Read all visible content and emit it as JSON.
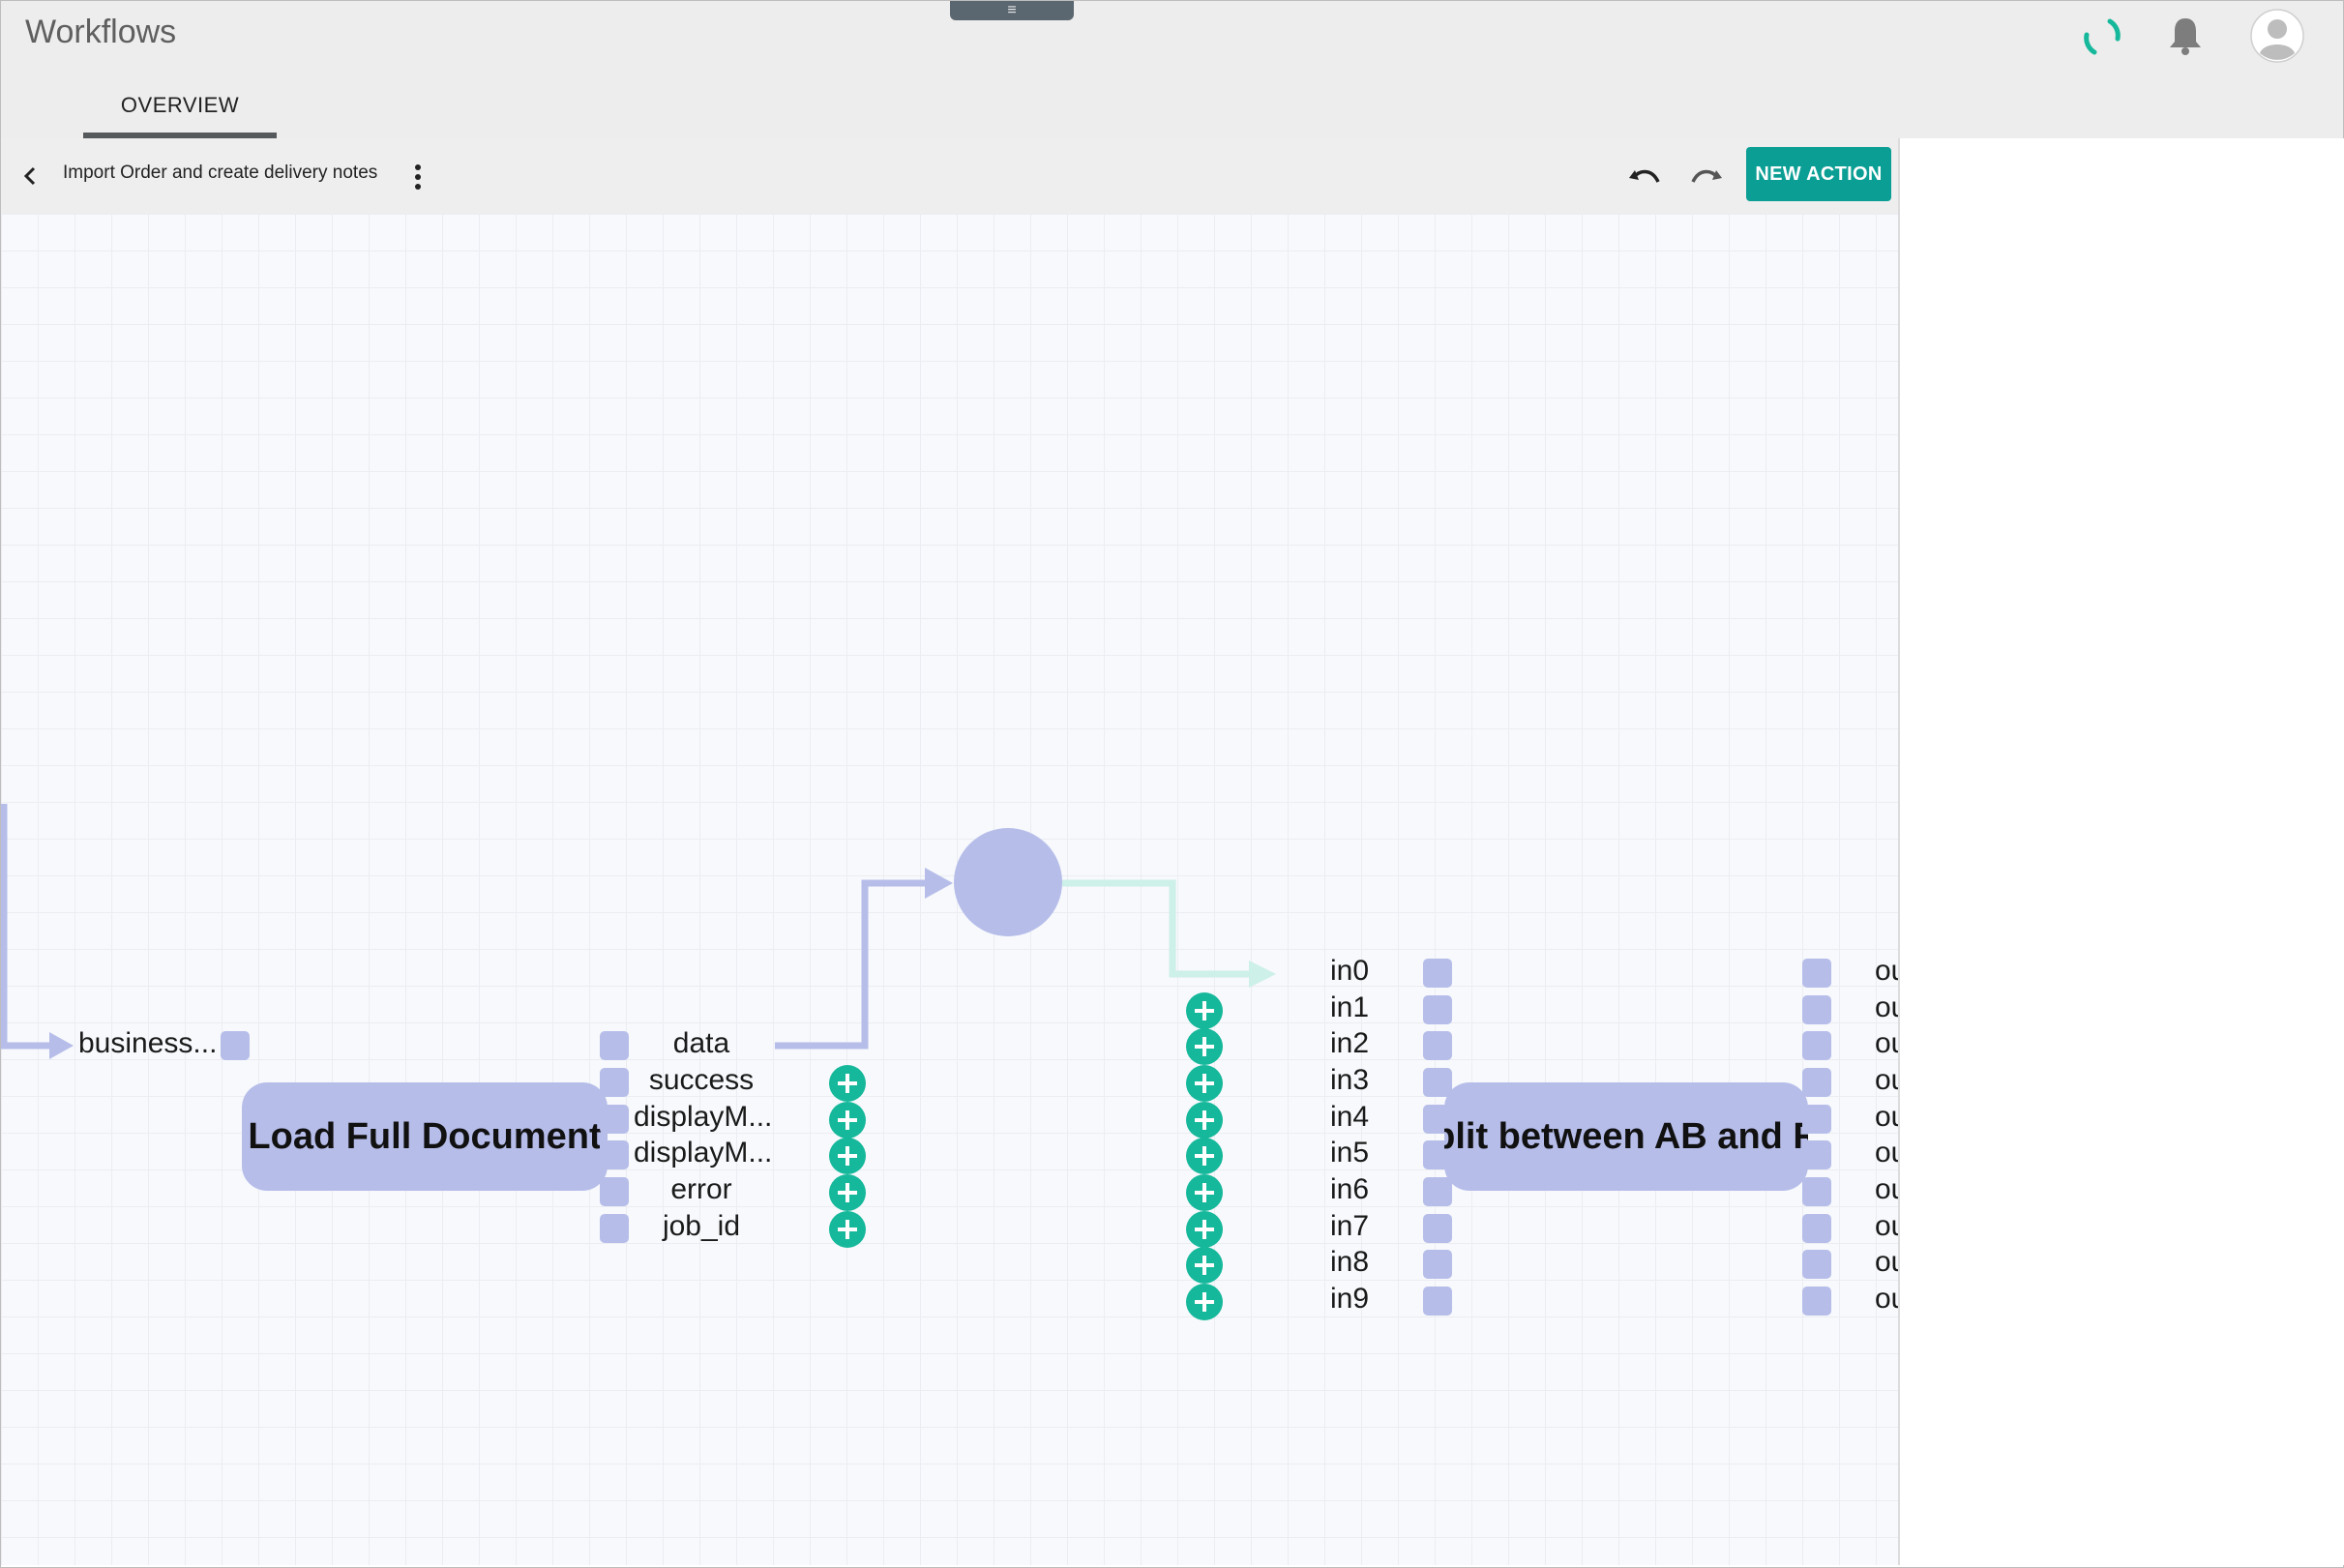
{
  "app": {
    "title": "Workflows",
    "drawer_handle": "≡"
  },
  "tabs": [
    {
      "label": "OVERVIEW",
      "active": true
    }
  ],
  "header_icons": [
    "loading-spinner-icon",
    "bell-icon",
    "user-avatar-icon"
  ],
  "toolbar": {
    "back_icon": "chevron-left-icon",
    "workflow_name": "Import Order and create delivery notes",
    "more_icon": "more-vertical-icon",
    "undo_icon": "undo-icon",
    "redo_icon": "redo-icon",
    "new_action_label": "NEW ACTION"
  },
  "colors": {
    "accent": "#0b9e94",
    "node": "#b6bde9",
    "plus": "#16b89b",
    "wire_active": "#b6bde9",
    "wire_pending": "#cdf0e8"
  },
  "nodes": [
    {
      "title": "Load Full Document",
      "inputs": [
        "business..."
      ],
      "outputs": [
        "data",
        "success",
        "displayM...",
        "displayM...",
        "error",
        "job_id"
      ]
    },
    {
      "title": "Split between AB and R...",
      "title_visible": "plit between AB and R",
      "inputs": [
        "in0",
        "in1",
        "in2",
        "in3",
        "in4",
        "in5",
        "in6",
        "in7",
        "in8",
        "in9"
      ],
      "outputs": [
        "ou",
        "ou",
        "ou",
        "ou",
        "ou",
        "ou",
        "ou",
        "ou",
        "ou",
        "ou"
      ]
    }
  ]
}
